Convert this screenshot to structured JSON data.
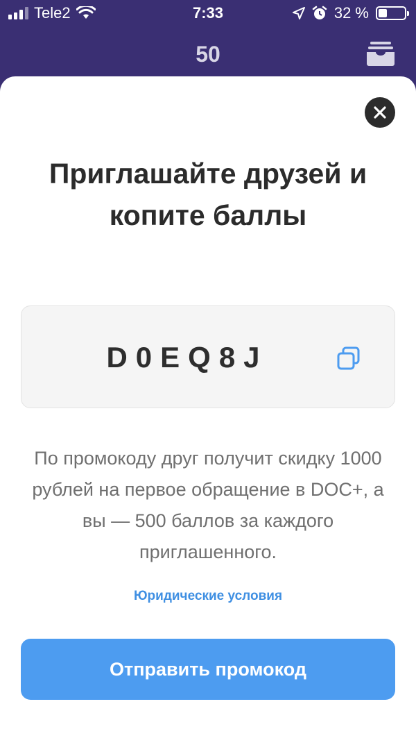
{
  "status_bar": {
    "carrier": "Tele2",
    "time": "7:33",
    "battery": "32 %",
    "battery_level": 0.32,
    "icons": [
      "signal-icon",
      "wifi-icon",
      "location-icon",
      "alarm-icon",
      "battery-icon"
    ]
  },
  "header": {
    "points": "50",
    "inbox_icon": "inbox-icon",
    "background_color": "#3a2f73"
  },
  "modal": {
    "close_icon": "close-icon",
    "title": "Приглашайте друзей и копите баллы",
    "promo_code": "D0EQ8J",
    "copy_icon": "copy-icon",
    "description": "По промокоду друг получит скидку 1000 рублей на первое обращение в DOC+, а вы — 500 баллов за каждого приглашенного.",
    "legal_link": "Юридические условия",
    "send_button": "Отправить промокод",
    "accent_color": "#4d9cf0"
  }
}
